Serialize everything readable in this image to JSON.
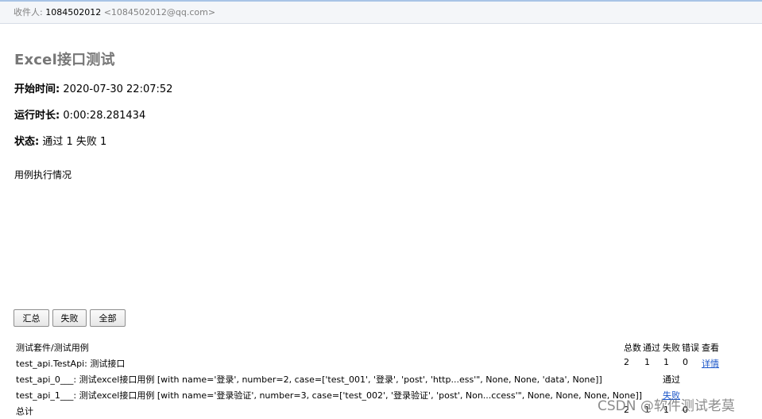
{
  "email": {
    "recipient_label": "收件人:",
    "recipient_name": "1084502012",
    "recipient_address": "<1084502012@qq.com>"
  },
  "report": {
    "title": "Excel接口测试",
    "start_label": "开始时间:",
    "start_value": "2020-07-30 22:07:52",
    "duration_label": "运行时长:",
    "duration_value": "0:00:28.281434",
    "status_label": "状态:",
    "status_value": "通过 1 失败 1",
    "section_label": "用例执行情况"
  },
  "buttons": {
    "summary": "汇总",
    "failed": "失败",
    "all": "全部"
  },
  "table": {
    "headers": {
      "suite_case": "测试套件/测试用例",
      "total": "总数",
      "pass": "通过",
      "fail": "失败",
      "error": "错误",
      "view": "查看"
    },
    "suite": {
      "name": "test_api.TestApi: 测试接口",
      "total": "2",
      "pass": "1",
      "fail": "1",
      "error": "0",
      "view": "详情"
    },
    "cases": [
      {
        "name": "test_api_0___: 测试excel接口用例 [with name='登录', number=2, case=['test_001', '登录', 'post', 'http...ess'\", None, None, 'data', None]]",
        "result": "通过"
      },
      {
        "name": "test_api_1___: 测试excel接口用例 [with name='登录验证', number=3, case=['test_002', '登录验证', 'post', Non...ccess'\", None, None, None, None]]",
        "result": "失败"
      }
    ],
    "footer": {
      "label": "总计",
      "total": "2",
      "pass": "1",
      "fail": "1",
      "error": "0"
    }
  },
  "watermark": "CSDN @软件测试老莫",
  "colors": {
    "link": "#1a55c9",
    "title": "#777777",
    "recipient_bar": "#f4f6f9"
  }
}
